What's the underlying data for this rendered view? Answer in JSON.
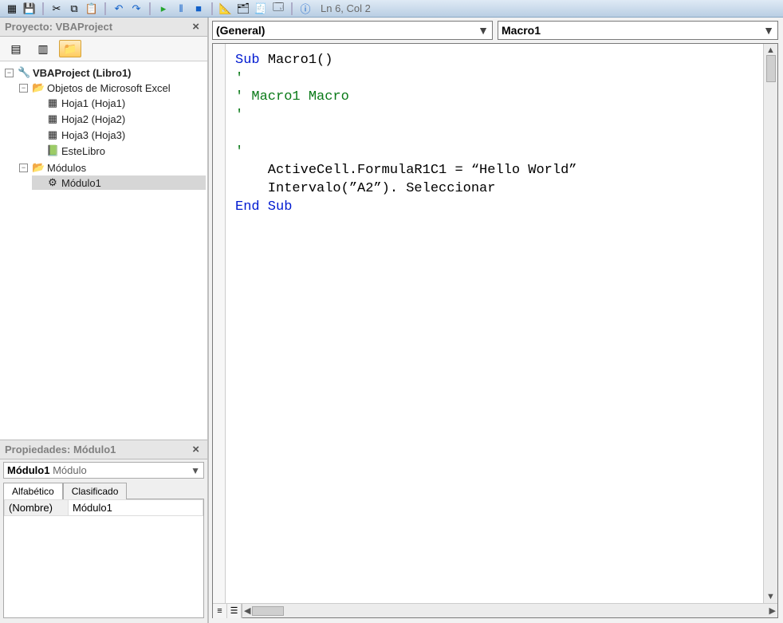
{
  "status_bar": {
    "position": "Ln 6, Col 2"
  },
  "toolbar_icons": [
    "excel",
    "save",
    "cut",
    "copy",
    "paste",
    "find",
    "undo",
    "redo",
    "run",
    "pause",
    "stop",
    "design",
    "project",
    "props",
    "object",
    "help"
  ],
  "project_panel": {
    "title": "Proyecto: VBAProject",
    "root": {
      "label": "VBAProject (Libro1)",
      "children": [
        {
          "label": "Objetos de Microsoft Excel",
          "icon": "folder",
          "children": [
            {
              "label": "Hoja1 (Hoja1)",
              "icon": "sheet"
            },
            {
              "label": "Hoja2 (Hoja2)",
              "icon": "sheet"
            },
            {
              "label": "Hoja3 (Hoja3)",
              "icon": "sheet"
            },
            {
              "label": "EsteLibro",
              "icon": "workbook"
            }
          ]
        },
        {
          "label": "Módulos",
          "icon": "folder",
          "children": [
            {
              "label": "Módulo1",
              "icon": "module",
              "selected": true
            }
          ]
        }
      ]
    }
  },
  "properties_panel": {
    "title": "Propiedades: Módulo1",
    "object_name": "Módulo1",
    "object_type": "Módulo",
    "tabs": {
      "alpha": "Alfabético",
      "categ": "Clasificado"
    },
    "rows": [
      {
        "name": "(Nombre)",
        "value": "Módulo1"
      }
    ]
  },
  "code_area": {
    "combo_left": "(General)",
    "combo_right": "Macro1",
    "lines": [
      {
        "t": "kw",
        "text": "Sub "
      },
      {
        "t": "",
        "text": "Macro1()"
      },
      {
        "br": true
      },
      {
        "t": "cm",
        "text": "'"
      },
      {
        "br": true
      },
      {
        "t": "cm",
        "text": "' Macro1 Macro"
      },
      {
        "br": true
      },
      {
        "t": "cm",
        "text": "'"
      },
      {
        "br": true
      },
      {
        "t": "",
        "text": ""
      },
      {
        "br": true
      },
      {
        "t": "cm",
        "text": "'"
      },
      {
        "br": true
      },
      {
        "t": "",
        "text": "    ActiveCell.FormulaR1C1 = “Hello World”"
      },
      {
        "br": true
      },
      {
        "t": "",
        "text": "    Intervalo(”A2”). Seleccionar"
      },
      {
        "br": true
      },
      {
        "t": "kw",
        "text": "End Sub"
      }
    ]
  }
}
